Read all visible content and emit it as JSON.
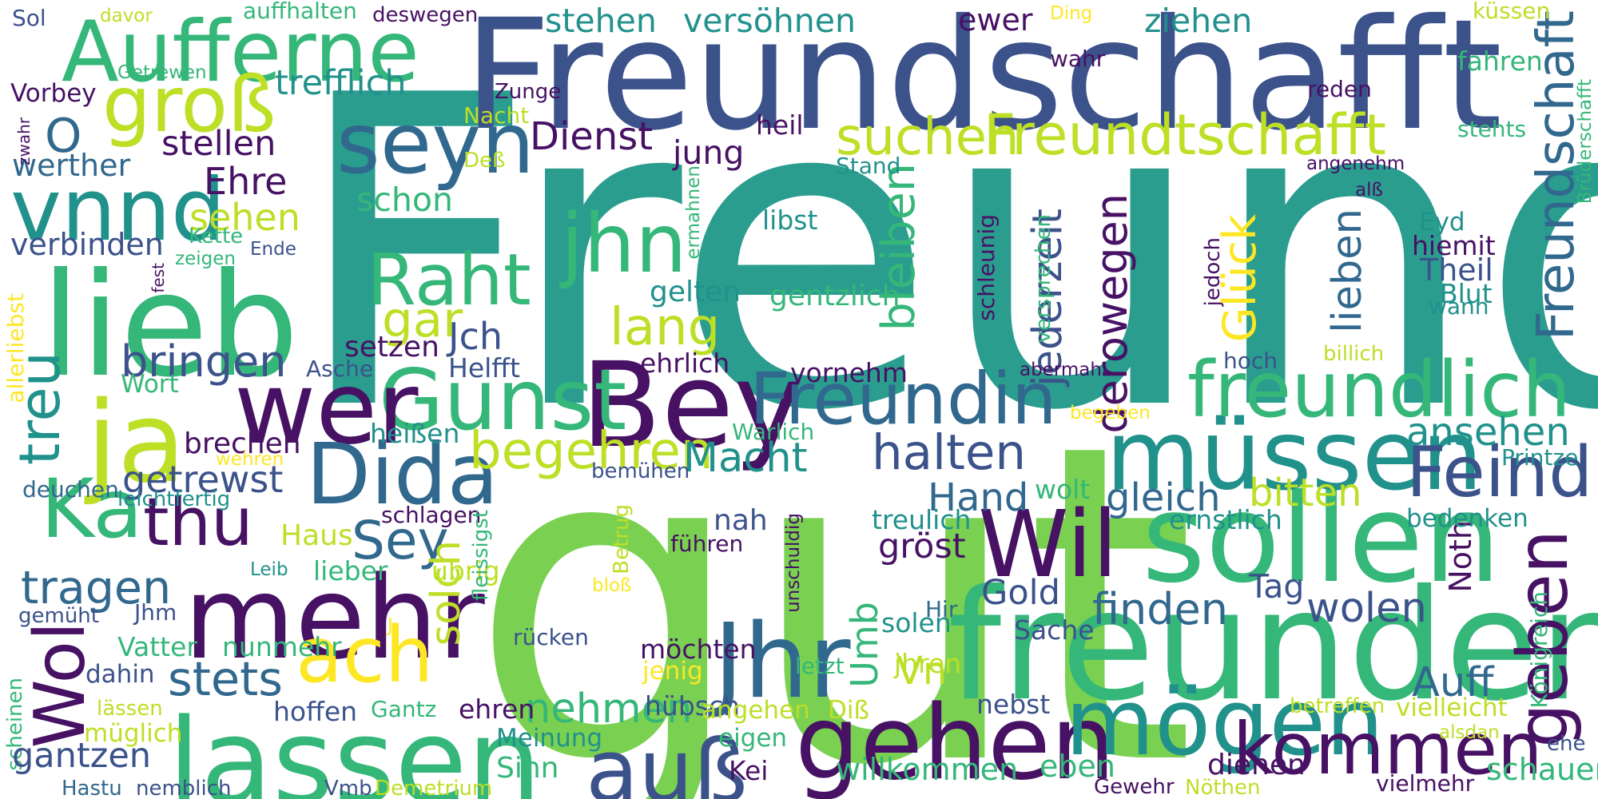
{
  "palette": {
    "teal": "#2a9d8f",
    "green": "#7ad151",
    "navy": "#3b528b",
    "purple": "#471164",
    "lime": "#bddf26",
    "yellow": "#fde725",
    "blue": "#31688e",
    "seagreen": "#35b779",
    "cyan": "#21918c"
  },
  "words": [
    "Freund",
    "gut",
    "Freundschafft",
    "freunden",
    "sollen",
    "lieb",
    "Bey",
    "Gunst",
    "wer",
    "ja",
    "müssen",
    "lassen",
    "mehr",
    "gehen",
    "Jhr",
    "mögen",
    "Aufferne",
    "vnnd",
    "seyn",
    "Dida",
    "Wil",
    "freundlich",
    "Freundin",
    "Raht",
    "Freundtschafft",
    "kommen",
    "Ka",
    "Wol",
    "jhn",
    "groß",
    "geben",
    "Feind",
    "auß",
    "ach",
    "thu",
    "treu",
    "Freundschaft",
    "suchen",
    "begehren",
    "halten",
    "Sey",
    "lang",
    "tragen",
    "Glück",
    "gar",
    "bleiben",
    "derowegen",
    "stets",
    "nehmen",
    "Macht",
    "bringen",
    "getrewst",
    "Ehre",
    "sehen",
    "stellen",
    "werther",
    "verbinden",
    "Dienst",
    "jung",
    "schon",
    "gleich",
    "bitten",
    "Hand",
    "finden",
    "wolen",
    "lieben",
    "jederzeit",
    "ansehen",
    "Auff",
    "Noth",
    "Umb",
    "solch",
    "Vn",
    "gehen2",
    "trefflich",
    "stehen",
    "versöhnen",
    "ewer",
    "ziehen",
    "O",
    "Jch",
    "setzen",
    "Helfft",
    "ehrlich",
    "vornehm",
    "gentzlich",
    "gelten",
    "heißen",
    "brechen",
    "Haus",
    "lieber",
    "übrig",
    "nah",
    "führen",
    "gröst",
    "Gold",
    "Tag",
    "Sache",
    "solen",
    "Hir",
    "treulich",
    "ernstlich",
    "bedenken",
    "wolt",
    "Printze",
    "Königreich",
    "Theil",
    "Blut",
    "wann",
    "Eyd",
    "hiemit",
    "libst",
    "Stand",
    "heil",
    "Nacht",
    "Zunge",
    "wahr",
    "reden",
    "fahren",
    "küssen",
    "stehts",
    "angenehm",
    "alß",
    "Deß",
    "ermahnen",
    "schleunig",
    "versprechen",
    "jedoch",
    "hoch",
    "abermahl",
    "billich",
    "begeben",
    "Warlich",
    "bemühen",
    "leichtfertig",
    "deuchen",
    "wehren",
    "Wort",
    "Asche",
    "allerliebst",
    "fest",
    "zeigen",
    "Ende",
    "Kette",
    "Getrewen",
    "Vorbey",
    "zwahr",
    "Sol",
    "davor",
    "auffhalten",
    "deswegen",
    "Ding",
    "Jhm",
    "gemüht",
    "Leib",
    "schlagen",
    "Betrug",
    "bloß",
    "unschuldig",
    "rücken",
    "letzt",
    "möchten",
    "jenig",
    "jhren",
    "hübsch",
    "angehen",
    "Diß",
    "ehren",
    "Gantz",
    "hoffen",
    "dahin",
    "Vatter",
    "nunmehr",
    "müglich",
    "lässen",
    "scheinen",
    "gantzen",
    "Hastu",
    "nemblich",
    "Vmb",
    "Demetrium",
    "Meinung",
    "eigen",
    "Kei",
    "Sinn",
    "willkommen",
    "eben",
    "Gewehr",
    "dienen",
    "nebst",
    "betreffen",
    "Nöthen",
    "vielleicht",
    "alsdan",
    "vielmehr",
    "schauen",
    "ehe",
    "Brüderschafft",
    "fleissigst",
    "J"
  ]
}
